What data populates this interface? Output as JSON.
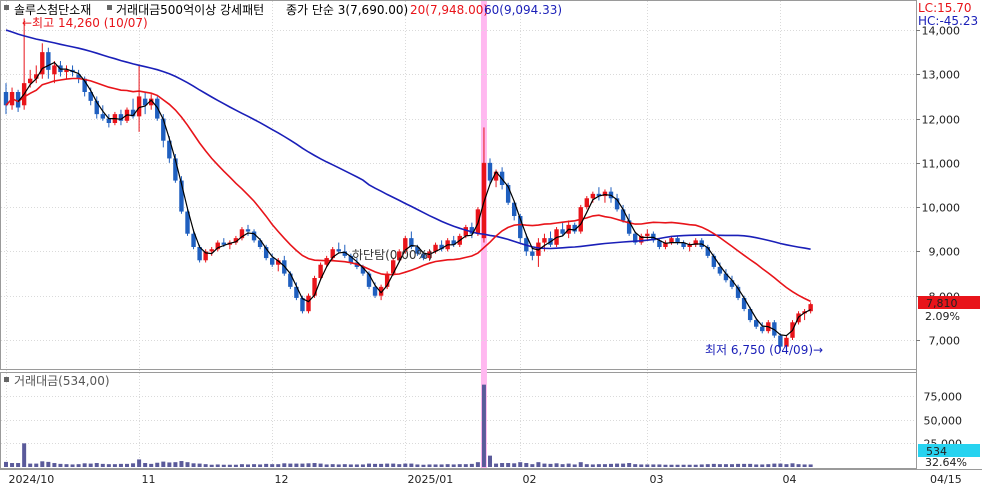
{
  "legend": {
    "stock_name": "솔루스첨단소재",
    "study_name": "거래대금500억이상 강세패턴",
    "ma3": "종가 단순 3(7,690.00)",
    "ma20": "20(7,948.00)",
    "ma60": "60(9,094.33)"
  },
  "indicators": {
    "lc": "LC:15.70",
    "hc": "HC:-45.23"
  },
  "annotations": {
    "high": "←최고 14,260 (10/07)",
    "low": "최저 6,750 (04/09)→",
    "mid": "하단탐(0,00%)"
  },
  "price_badge": {
    "value": "7,810",
    "change": "2.09%"
  },
  "volume": {
    "title": "거래대금(534,00)",
    "badge_value": "534",
    "badge_pct": "32.64%"
  },
  "colors": {
    "up": "#e8141a",
    "down": "#1f5fbf",
    "ma3": "#000000",
    "ma20": "#e8141a",
    "ma60": "#1a1fb8",
    "highlight": "#ffb8f0",
    "volume_bar": "#5a5a9a",
    "badge": "#e8141a",
    "vol_badge": "#27d3f0"
  },
  "chart_data": {
    "type": "candlestick",
    "title": "솔루스첨단소재",
    "price_axis": {
      "ylim": [
        6200,
        14300
      ],
      "ticks": [
        7000,
        8000,
        9000,
        10000,
        11000,
        12000,
        13000,
        14000
      ],
      "tick_labels": [
        "7,000",
        "8,000",
        "9,000",
        "10,000",
        "11,000",
        "12,000",
        "13,000",
        "14,000"
      ]
    },
    "volume_axis": {
      "ylim": [
        0,
        95000
      ],
      "ticks": [
        25000,
        50000,
        75000
      ],
      "tick_labels": [
        "25,000",
        "50,000",
        "75,000"
      ]
    },
    "x_axis": {
      "tick_labels": [
        "2024/10",
        "11",
        "12",
        "2025/01",
        "02",
        "03",
        "04"
      ],
      "tick_index": [
        0,
        22,
        44,
        66,
        85,
        106,
        128
      ],
      "end_label": "04/15"
    },
    "highlight_index": 79,
    "series": [
      {
        "name": "종가 단순 3",
        "last": 7690
      },
      {
        "name": "20",
        "last": 7948
      },
      {
        "name": "60",
        "last": 9094.33
      }
    ],
    "ohlc": [
      [
        12600,
        12800,
        12100,
        12300
      ],
      [
        12300,
        12700,
        12200,
        12600
      ],
      [
        12600,
        12650,
        12150,
        12250
      ],
      [
        12300,
        14260,
        12200,
        12800
      ],
      [
        12800,
        13100,
        12700,
        12900
      ],
      [
        12900,
        13200,
        12800,
        13000
      ],
      [
        13000,
        13700,
        12900,
        13500
      ],
      [
        13500,
        13600,
        12900,
        13100
      ],
      [
        13000,
        13300,
        12800,
        13200
      ],
      [
        13200,
        13300,
        12950,
        13050
      ],
      [
        13050,
        13200,
        12900,
        13100
      ],
      [
        13100,
        13200,
        12950,
        13050
      ],
      [
        13000,
        13100,
        12800,
        12900
      ],
      [
        12900,
        12950,
        12500,
        12600
      ],
      [
        12600,
        12700,
        12300,
        12400
      ],
      [
        12400,
        12500,
        12000,
        12100
      ],
      [
        12100,
        12300,
        11950,
        12000
      ],
      [
        12000,
        12100,
        11800,
        11900
      ],
      [
        11900,
        12150,
        11850,
        12100
      ],
      [
        12100,
        12200,
        11850,
        11950
      ],
      [
        11950,
        12250,
        11900,
        12200
      ],
      [
        12200,
        12450,
        12000,
        12050
      ],
      [
        12050,
        13200,
        11700,
        12500
      ],
      [
        12450,
        12600,
        12100,
        12300
      ],
      [
        12300,
        12550,
        12200,
        12450
      ],
      [
        12450,
        12500,
        11950,
        12000
      ],
      [
        12000,
        12100,
        11350,
        11500
      ],
      [
        11500,
        11600,
        11000,
        11100
      ],
      [
        11100,
        11200,
        10550,
        10600
      ],
      [
        10600,
        10700,
        9850,
        9900
      ],
      [
        9900,
        10000,
        9350,
        9400
      ],
      [
        9400,
        9500,
        9050,
        9100
      ],
      [
        9100,
        9150,
        8750,
        8800
      ],
      [
        8800,
        9050,
        8750,
        9000
      ],
      [
        9000,
        9100,
        8900,
        9050
      ],
      [
        9050,
        9250,
        9000,
        9200
      ],
      [
        9200,
        9300,
        9100,
        9150
      ],
      [
        9150,
        9250,
        9050,
        9200
      ],
      [
        9200,
        9350,
        9150,
        9300
      ],
      [
        9300,
        9550,
        9250,
        9500
      ],
      [
        9500,
        9600,
        9350,
        9450
      ],
      [
        9450,
        9500,
        9200,
        9250
      ],
      [
        9250,
        9300,
        9050,
        9100
      ],
      [
        9100,
        9150,
        8800,
        8850
      ],
      [
        8850,
        8950,
        8650,
        8700
      ],
      [
        8700,
        8850,
        8550,
        8800
      ],
      [
        8800,
        8900,
        8450,
        8500
      ],
      [
        8500,
        8550,
        8150,
        8200
      ],
      [
        8200,
        8300,
        7900,
        7950
      ],
      [
        7950,
        8000,
        7600,
        7650
      ],
      [
        7650,
        8050,
        7600,
        8000
      ],
      [
        8000,
        8450,
        7950,
        8400
      ],
      [
        8400,
        8750,
        8350,
        8700
      ],
      [
        8700,
        8900,
        8650,
        8850
      ],
      [
        8850,
        9100,
        8800,
        9050
      ],
      [
        9050,
        9200,
        8950,
        9000
      ],
      [
        9000,
        9150,
        8850,
        8900
      ],
      [
        8900,
        8950,
        8700,
        8750
      ],
      [
        8750,
        8850,
        8600,
        8650
      ],
      [
        8650,
        8700,
        8450,
        8500
      ],
      [
        8500,
        8550,
        8150,
        8200
      ],
      [
        8200,
        8300,
        7950,
        8000
      ],
      [
        8000,
        8250,
        7900,
        8200
      ],
      [
        8200,
        8550,
        8150,
        8500
      ],
      [
        8500,
        8850,
        8450,
        8800
      ],
      [
        8800,
        9050,
        8750,
        9000
      ],
      [
        9000,
        9350,
        8950,
        9300
      ],
      [
        9300,
        9450,
        9050,
        9100
      ],
      [
        9100,
        9150,
        8900,
        8950
      ],
      [
        8950,
        9000,
        8800,
        8850
      ],
      [
        8850,
        9050,
        8800,
        9000
      ],
      [
        9000,
        9200,
        8950,
        9150
      ],
      [
        9150,
        9250,
        9000,
        9050
      ],
      [
        9050,
        9300,
        9000,
        9250
      ],
      [
        9250,
        9350,
        9100,
        9150
      ],
      [
        9150,
        9400,
        9100,
        9350
      ],
      [
        9350,
        9600,
        9300,
        9550
      ],
      [
        9550,
        9650,
        9300,
        9400
      ],
      [
        9400,
        10000,
        9350,
        9950
      ],
      [
        9300,
        11800,
        9200,
        11000
      ],
      [
        11000,
        11100,
        10500,
        10600
      ],
      [
        10600,
        10850,
        10450,
        10800
      ],
      [
        10800,
        10900,
        10400,
        10500
      ],
      [
        10500,
        10550,
        10050,
        10100
      ],
      [
        10100,
        10150,
        9700,
        9800
      ],
      [
        9800,
        9850,
        9200,
        9300
      ],
      [
        9300,
        9400,
        8900,
        9000
      ],
      [
        9000,
        9100,
        8800,
        8900
      ],
      [
        8900,
        9300,
        8650,
        9200
      ],
      [
        9200,
        9400,
        9000,
        9300
      ],
      [
        9300,
        9450,
        9100,
        9150
      ],
      [
        9150,
        9550,
        9100,
        9500
      ],
      [
        9500,
        9650,
        9350,
        9400
      ],
      [
        9400,
        9700,
        9300,
        9600
      ],
      [
        9600,
        9650,
        9400,
        9450
      ],
      [
        9450,
        10050,
        9400,
        10000
      ],
      [
        10000,
        10250,
        9950,
        10200
      ],
      [
        10200,
        10350,
        10100,
        10300
      ],
      [
        10300,
        10450,
        10150,
        10250
      ],
      [
        10250,
        10400,
        10100,
        10350
      ],
      [
        10350,
        10450,
        10100,
        10200
      ],
      [
        10200,
        10300,
        9900,
        9950
      ],
      [
        9950,
        10050,
        9650,
        9700
      ],
      [
        9700,
        9850,
        9350,
        9400
      ],
      [
        9400,
        9450,
        9150,
        9200
      ],
      [
        9200,
        9400,
        9150,
        9350
      ],
      [
        9350,
        9500,
        9250,
        9400
      ],
      [
        9400,
        9450,
        9200,
        9250
      ],
      [
        9250,
        9300,
        9050,
        9100
      ],
      [
        9100,
        9250,
        9050,
        9200
      ],
      [
        9200,
        9350,
        9150,
        9300
      ],
      [
        9300,
        9350,
        9150,
        9200
      ],
      [
        9200,
        9250,
        9050,
        9100
      ],
      [
        9100,
        9200,
        9000,
        9150
      ],
      [
        9150,
        9300,
        9100,
        9250
      ],
      [
        9250,
        9300,
        9050,
        9100
      ],
      [
        9100,
        9150,
        8850,
        8900
      ],
      [
        8900,
        8950,
        8600,
        8650
      ],
      [
        8650,
        8750,
        8450,
        8500
      ],
      [
        8500,
        8600,
        8300,
        8350
      ],
      [
        8350,
        8450,
        8150,
        8200
      ],
      [
        8200,
        8250,
        7900,
        7950
      ],
      [
        7950,
        8000,
        7650,
        7700
      ],
      [
        7700,
        7750,
        7400,
        7450
      ],
      [
        7450,
        7500,
        7250,
        7300
      ],
      [
        7300,
        7400,
        7150,
        7200
      ],
      [
        7200,
        7450,
        7150,
        7400
      ],
      [
        7400,
        7450,
        7050,
        7100
      ],
      [
        7100,
        7150,
        6750,
        6850
      ],
      [
        6850,
        7100,
        6800,
        7050
      ],
      [
        7050,
        7450,
        7000,
        7400
      ],
      [
        7400,
        7650,
        7350,
        7600
      ],
      [
        7600,
        7700,
        7450,
        7650
      ],
      [
        7650,
        7850,
        7600,
        7810
      ]
    ],
    "ma3": [
      null,
      null,
      12383,
      12550,
      12767,
      12900,
      13133,
      13200,
      13267,
      13117,
      13117,
      13067,
      13017,
      12850,
      12633,
      12367,
      12167,
      12000,
      12000,
      11983,
      12083,
      12067,
      12250,
      12283,
      12417,
      12250,
      11983,
      11550,
      11067,
      10533,
      9967,
      9467,
      9100,
      8967,
      8950,
      9083,
      9133,
      9183,
      9217,
      9333,
      9417,
      9400,
      9267,
      9067,
      8883,
      8783,
      8667,
      8500,
      8217,
      7933,
      7867,
      8017,
      8367,
      8650,
      8867,
      8967,
      8983,
      8883,
      8767,
      8633,
      8483,
      8233,
      8067,
      8233,
      8500,
      8767,
      9033,
      9133,
      9117,
      8967,
      8933,
      9000,
      9067,
      9150,
      9150,
      9250,
      9350,
      9367,
      9633,
      10117,
      10517,
      10800,
      10633,
      10467,
      10133,
      9733,
      9367,
      9067,
      9033,
      9133,
      9217,
      9317,
      9350,
      9500,
      9483,
      9617,
      9883,
      10167,
      10250,
      10283,
      10267,
      10167,
      9950,
      9683,
      9433,
      9317,
      9317,
      9317,
      9250,
      9183,
      9200,
      9200,
      9200,
      9150,
      9167,
      9167,
      9083,
      8883,
      8683,
      8500,
      8350,
      8167,
      7950,
      7717,
      7483,
      7317,
      7300,
      7233,
      7117,
      7100,
      7217,
      7517,
      7617,
      7687
    ]
  }
}
